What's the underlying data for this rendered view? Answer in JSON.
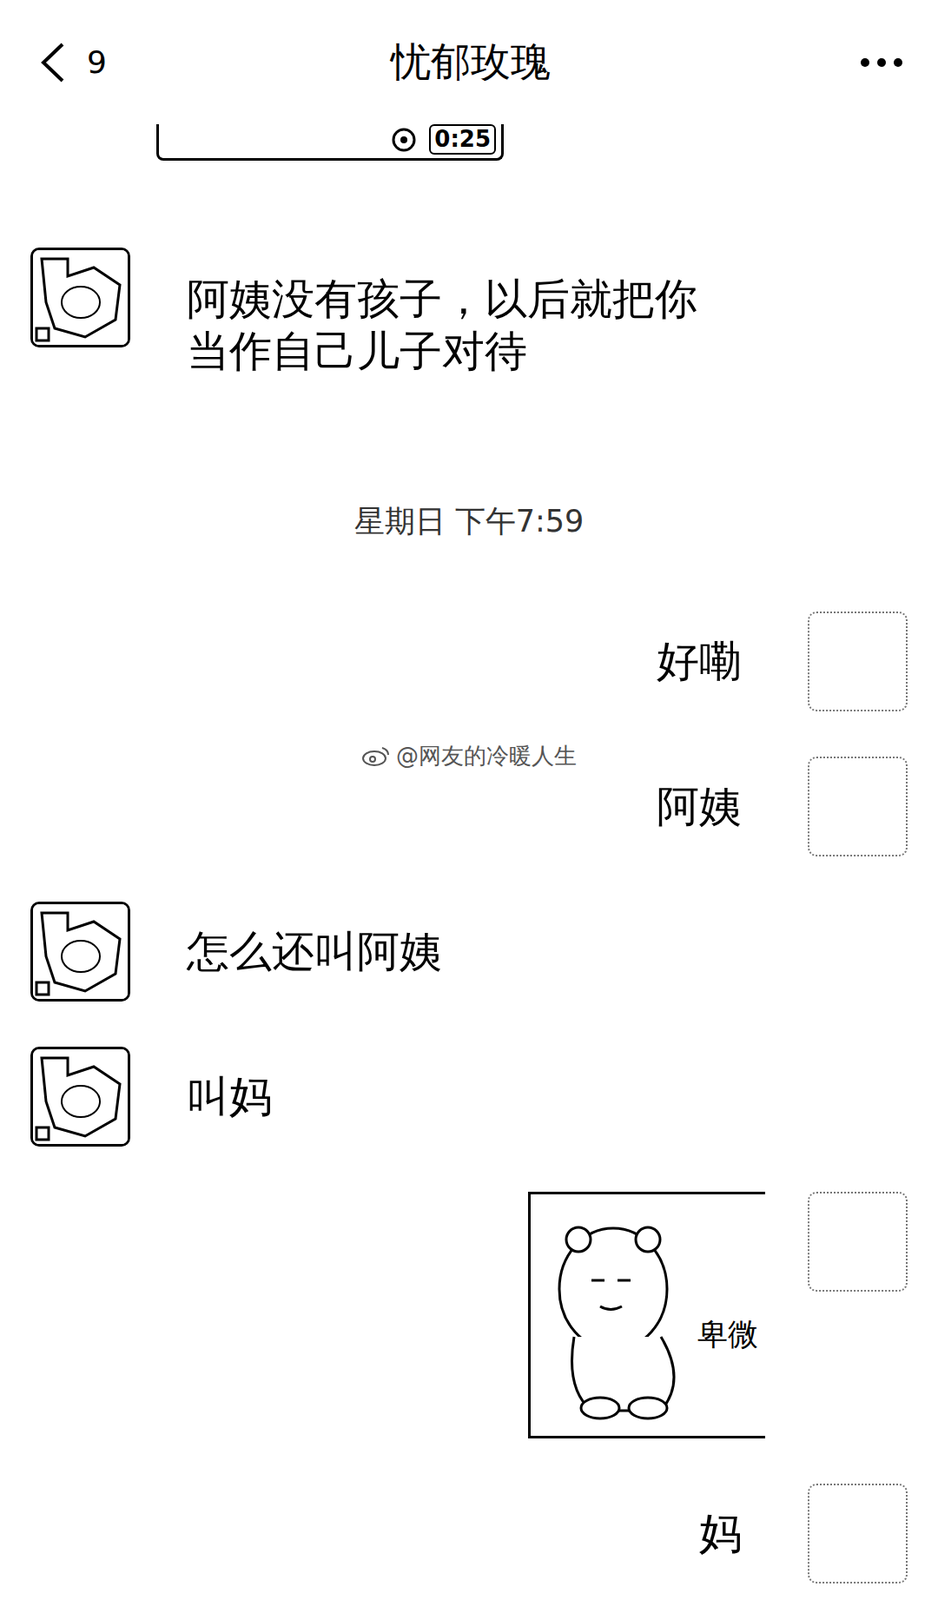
{
  "header": {
    "back_count": "9",
    "title": "忧郁玫瑰"
  },
  "messages": [
    {
      "kind": "video",
      "duration": "0:25"
    },
    {
      "kind": "text",
      "side": "left",
      "text": "阿姨没有孩子，以后就把你当作自己儿子对待"
    },
    {
      "kind": "time",
      "text": "星期日 下午7:59"
    },
    {
      "kind": "text",
      "side": "right",
      "text": "好嘞"
    },
    {
      "kind": "text",
      "side": "right",
      "text": "阿姨"
    },
    {
      "kind": "text",
      "side": "left",
      "text": "怎么还叫阿姨"
    },
    {
      "kind": "text",
      "side": "left",
      "text": "叫妈"
    },
    {
      "kind": "sticker",
      "side": "right",
      "caption": "卑微"
    },
    {
      "kind": "text",
      "side": "right",
      "text": "妈"
    }
  ],
  "watermark": "@网友的冷暖人生"
}
